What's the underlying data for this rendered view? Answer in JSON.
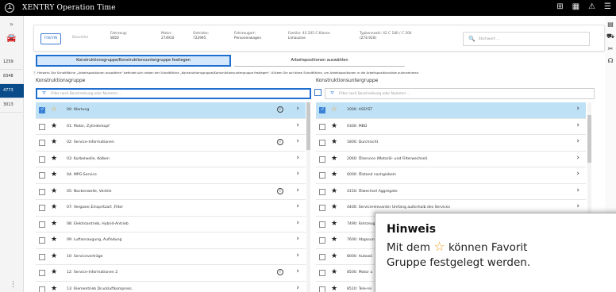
{
  "app": {
    "title": "XENTRY Operation Time"
  },
  "titlebar_icons": [
    "network-icon",
    "grid-icon",
    "warning-icon",
    "menu-icon"
  ],
  "left_nav": {
    "expand": "»",
    "items": [
      "1259",
      "8348",
      "4773",
      "3013"
    ],
    "active": 2,
    "more": "⋮"
  },
  "vehicle": {
    "finvin": "FIN/VIN",
    "baureihe": "Baureihe",
    "fields": [
      {
        "label": "Fahrzeug:",
        "value": "WDD"
      },
      {
        "label": "Motor:",
        "value": "274910"
      },
      {
        "label": "Getriebe:",
        "value": "722995"
      },
      {
        "label": "Fahrzeugart:",
        "value": "Personenwagen"
      },
      {
        "label": "Familie: 4S 205 C-Klasse",
        "value": "Limousine"
      },
      {
        "label": "Typkennzahl: 42 C 180 / C 200",
        "value": "(274.910)"
      }
    ],
    "search_placeholder": "Stichwort ..."
  },
  "tabs": {
    "active": "Konstruktionsgruppe/Konstruktionsuntergruppe festlegen",
    "second": "Arbeitspositionen auswählen"
  },
  "hint": "ⓘ Hinweis: Die Schaltfläche „Arbeitspositionen auswählen“ befindet sich neben der Schaltfläche „Konstruktionsgruppe/Konstruktionsuntergruppe festlegen“. Klicken Sie auf diese Schaltfläche, um Arbeitspositionen in die Arbeitspositionsliste aufzunehmen.",
  "left_panel": {
    "header": "Konstruktionsgruppe",
    "filter_placeholder": "Filter nach Beschreibung oder Nummer ...",
    "rows": [
      {
        "label": "00: Wartung",
        "checked": true,
        "fav": true,
        "info": true,
        "selected": true
      },
      {
        "label": "01: Motor, Zylinderkopf",
        "checked": false,
        "fav": false,
        "info": false,
        "selected": false
      },
      {
        "label": "02: Service-Informationen",
        "checked": false,
        "fav": false,
        "info": true,
        "selected": false
      },
      {
        "label": "03: Kurbelwelle, Kolben",
        "checked": false,
        "fav": false,
        "info": false,
        "selected": false
      },
      {
        "label": "04: MPG-Service",
        "checked": false,
        "fav": false,
        "info": false,
        "selected": false
      },
      {
        "label": "05: Nockenwelle, Ventile",
        "checked": false,
        "fav": false,
        "info": true,
        "selected": false
      },
      {
        "label": "07: Vergaser,Einspritzart ,Filter",
        "checked": false,
        "fav": false,
        "info": false,
        "selected": false
      },
      {
        "label": "08: Elektroantrieb, Hybrid-Antrieb",
        "checked": false,
        "fav": false,
        "info": false,
        "selected": false
      },
      {
        "label": "09: Luftansaugung, Aufladung",
        "checked": false,
        "fav": false,
        "info": false,
        "selected": false
      },
      {
        "label": "10: Serviceverträge",
        "checked": false,
        "fav": false,
        "info": false,
        "selected": false
      },
      {
        "label": "12: Service-Informationen 2",
        "checked": false,
        "fav": false,
        "info": true,
        "selected": false
      },
      {
        "label": "13: Riementrieb Druckluftkompress.",
        "checked": false,
        "fav": false,
        "info": false,
        "selected": false
      }
    ]
  },
  "right_panel": {
    "header": "Konstruktionsuntergruppe",
    "filter_placeholder": "Filter nach Beschreibung oder Nummer ...",
    "rows": [
      {
        "label": "1000: ASSYST",
        "checked": true,
        "fav": true,
        "selected": true
      },
      {
        "label": "0300: MBD",
        "checked": false,
        "fav": false,
        "selected": false
      },
      {
        "label": "1800: Durchsicht",
        "checked": false,
        "fav": false,
        "selected": false
      },
      {
        "label": "2060: Ölservice (Motoröl- und Filterwechsel)",
        "checked": false,
        "fav": false,
        "selected": false
      },
      {
        "label": "6000: Ölstand nachgiebeln",
        "checked": false,
        "fav": false,
        "selected": false
      },
      {
        "label": "4150: Ölwechsel Aggregate",
        "checked": false,
        "fav": false,
        "selected": false
      },
      {
        "label": "4400: Servicerelevanter Umfang außerhalb des Services",
        "checked": false,
        "fav": false,
        "selected": false
      },
      {
        "label": "7490: Fahrzeug",
        "checked": false,
        "fav": false,
        "selected": false
      },
      {
        "label": "7600: Abgasun",
        "checked": false,
        "fav": false,
        "selected": false
      },
      {
        "label": "8000: Autowä",
        "checked": false,
        "fav": false,
        "selected": false
      },
      {
        "label": "8500: Motor u",
        "checked": false,
        "fav": false,
        "selected": false
      },
      {
        "label": "8510: Tele-rei",
        "checked": false,
        "fav": false,
        "selected": false
      }
    ]
  },
  "note": {
    "title": "Hinweis",
    "body_before": "Mit dem",
    "body_after": "können Favorit",
    "line2": "Gruppe festgelegt werden."
  }
}
